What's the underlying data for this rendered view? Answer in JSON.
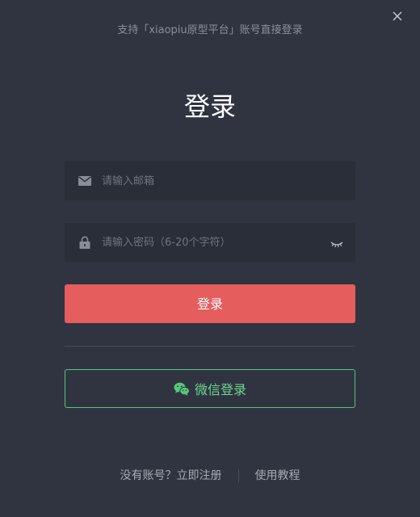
{
  "header": {
    "subtitle": "支持「xiaopiu原型平台」账号直接登录",
    "title": "登录"
  },
  "form": {
    "email_placeholder": "请输入邮箱",
    "password_placeholder": "请输入密码（6-20个字符）"
  },
  "buttons": {
    "login_label": "登录",
    "wechat_label": "微信登录"
  },
  "footer": {
    "register_label": "没有账号？立即注册",
    "tutorial_label": "使用教程"
  },
  "colors": {
    "background": "#303440",
    "field_background": "#2a2e38",
    "primary": "#e55d5d",
    "wechat_green": "#54c97a"
  },
  "icons": {
    "close": "close-icon",
    "email": "envelope-icon",
    "password": "lock-icon",
    "toggle": "eye-closed-icon",
    "wechat": "wechat-icon"
  }
}
